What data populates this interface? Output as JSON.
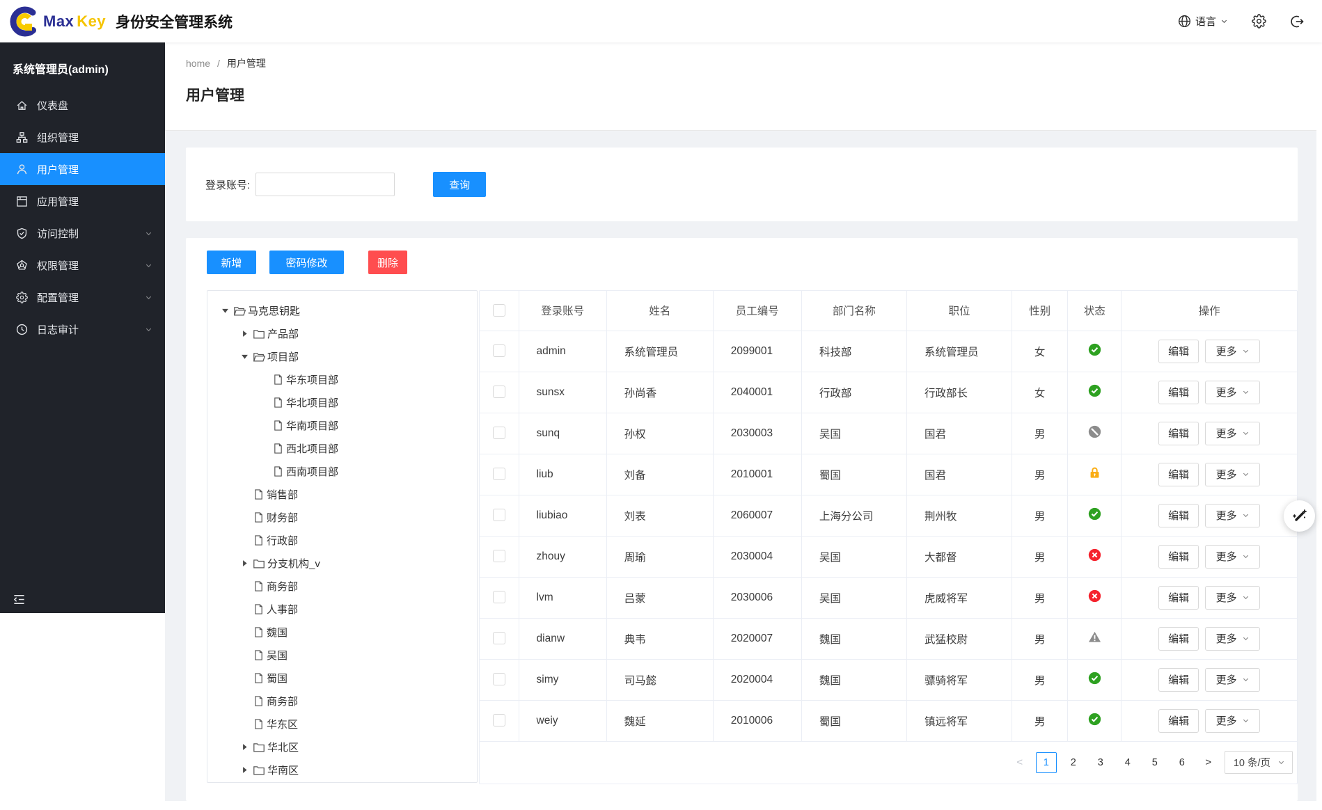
{
  "colors": {
    "accent": "#1890ff",
    "danger": "#ff4d4f",
    "success": "#2ea121",
    "warning_orange": "#faad14",
    "error_red": "#f5222d",
    "muted_gray": "#8c8c8c",
    "sidebar_bg": "#20232a",
    "page_bg": "#f0f2f5"
  },
  "header": {
    "brand_max": "Max",
    "brand_key": "Key",
    "subtitle": "身份安全管理系统",
    "language_label": "语言",
    "icons": [
      "globe-icon",
      "gear-icon",
      "logout-icon"
    ]
  },
  "sidebar": {
    "user_title": "系统管理员(admin)",
    "items": [
      {
        "id": "dashboard",
        "label": "仪表盘",
        "icon": "home-icon",
        "active": false,
        "expandable": false
      },
      {
        "id": "org",
        "label": "组织管理",
        "icon": "org-icon",
        "active": false,
        "expandable": false
      },
      {
        "id": "users",
        "label": "用户管理",
        "icon": "user-icon",
        "active": true,
        "expandable": false
      },
      {
        "id": "apps",
        "label": "应用管理",
        "icon": "app-icon",
        "active": false,
        "expandable": false
      },
      {
        "id": "access",
        "label": "访问控制",
        "icon": "shield-icon",
        "active": false,
        "expandable": true
      },
      {
        "id": "perms",
        "label": "权限管理",
        "icon": "badge-icon",
        "active": false,
        "expandable": true
      },
      {
        "id": "config",
        "label": "配置管理",
        "icon": "gear-icon",
        "active": false,
        "expandable": true
      },
      {
        "id": "audit",
        "label": "日志审计",
        "icon": "clock-icon",
        "active": false,
        "expandable": true
      }
    ]
  },
  "breadcrumb": {
    "home": "home",
    "separator": "/",
    "current": "用户管理"
  },
  "page": {
    "title": "用户管理"
  },
  "search": {
    "label": "登录账号:",
    "value": "",
    "query_button": "查询"
  },
  "toolbar": {
    "add": "新增",
    "change_password": "密码修改",
    "delete": "删除"
  },
  "tree": {
    "items": [
      {
        "label": "马克思钥匙",
        "level": 0,
        "caret": "expanded",
        "icon": "folder-open-icon"
      },
      {
        "label": "产品部",
        "level": 1,
        "caret": "collapsed",
        "icon": "folder-icon"
      },
      {
        "label": "项目部",
        "level": 1,
        "caret": "expanded",
        "icon": "folder-open-icon"
      },
      {
        "label": "华东项目部",
        "level": 2,
        "caret": "none",
        "icon": "file-icon"
      },
      {
        "label": "华北项目部",
        "level": 2,
        "caret": "none",
        "icon": "file-icon"
      },
      {
        "label": "华南项目部",
        "level": 2,
        "caret": "none",
        "icon": "file-icon"
      },
      {
        "label": "西北项目部",
        "level": 2,
        "caret": "none",
        "icon": "file-icon"
      },
      {
        "label": "西南项目部",
        "level": 2,
        "caret": "none",
        "icon": "file-icon"
      },
      {
        "label": "销售部",
        "level": 1,
        "caret": "none",
        "icon": "file-icon"
      },
      {
        "label": "财务部",
        "level": 1,
        "caret": "none",
        "icon": "file-icon"
      },
      {
        "label": "行政部",
        "level": 1,
        "caret": "none",
        "icon": "file-icon"
      },
      {
        "label": "分支机构_v",
        "level": 1,
        "caret": "collapsed",
        "icon": "folder-icon"
      },
      {
        "label": "商务部",
        "level": 1,
        "caret": "none",
        "icon": "file-icon"
      },
      {
        "label": "人事部",
        "level": 1,
        "caret": "none",
        "icon": "file-icon"
      },
      {
        "label": "魏国",
        "level": 1,
        "caret": "none",
        "icon": "file-icon"
      },
      {
        "label": "吴国",
        "level": 1,
        "caret": "none",
        "icon": "file-icon"
      },
      {
        "label": "蜀国",
        "level": 1,
        "caret": "none",
        "icon": "file-icon"
      },
      {
        "label": "商务部",
        "level": 1,
        "caret": "none",
        "icon": "file-icon"
      },
      {
        "label": "华东区",
        "level": 1,
        "caret": "none",
        "icon": "file-icon"
      },
      {
        "label": "华北区",
        "level": 1,
        "caret": "collapsed",
        "icon": "folder-icon"
      },
      {
        "label": "华南区",
        "level": 1,
        "caret": "collapsed",
        "icon": "folder-icon"
      }
    ]
  },
  "table": {
    "headers": [
      "登录账号",
      "姓名",
      "员工编号",
      "部门名称",
      "职位",
      "性别",
      "状态",
      "操作"
    ],
    "edit_label": "编辑",
    "more_label": "更多",
    "rows": [
      {
        "account": "admin",
        "name": "系统管理员",
        "employee_id": "2099001",
        "department": "科技部",
        "position": "系统管理员",
        "gender": "女",
        "status": "enabled"
      },
      {
        "account": "sunsx",
        "name": "孙尚香",
        "employee_id": "2040001",
        "department": "行政部",
        "position": "行政部长",
        "gender": "女",
        "status": "enabled"
      },
      {
        "account": "sunq",
        "name": "孙权",
        "employee_id": "2030003",
        "department": "吴国",
        "position": "国君",
        "gender": "男",
        "status": "disabled"
      },
      {
        "account": "liub",
        "name": "刘备",
        "employee_id": "2010001",
        "department": "蜀国",
        "position": "国君",
        "gender": "男",
        "status": "locked"
      },
      {
        "account": "liubiao",
        "name": "刘表",
        "employee_id": "2060007",
        "department": "上海分公司",
        "position": "荆州牧",
        "gender": "男",
        "status": "enabled"
      },
      {
        "account": "zhouy",
        "name": "周瑜",
        "employee_id": "2030004",
        "department": "吴国",
        "position": "大都督",
        "gender": "男",
        "status": "error"
      },
      {
        "account": "lvm",
        "name": "吕蒙",
        "employee_id": "2030006",
        "department": "吴国",
        "position": "虎威将军",
        "gender": "男",
        "status": "error"
      },
      {
        "account": "dianw",
        "name": "典韦",
        "employee_id": "2020007",
        "department": "魏国",
        "position": "武猛校尉",
        "gender": "男",
        "status": "warning"
      },
      {
        "account": "simy",
        "name": "司马懿",
        "employee_id": "2020004",
        "department": "魏国",
        "position": "骠骑将军",
        "gender": "男",
        "status": "enabled"
      },
      {
        "account": "weiy",
        "name": "魏延",
        "employee_id": "2010006",
        "department": "蜀国",
        "position": "镇远将军",
        "gender": "男",
        "status": "enabled"
      }
    ]
  },
  "pagination": {
    "prev": "<",
    "next": ">",
    "pages": [
      "1",
      "2",
      "3",
      "4",
      "5",
      "6"
    ],
    "current": "1",
    "page_size": "10 条/页"
  }
}
